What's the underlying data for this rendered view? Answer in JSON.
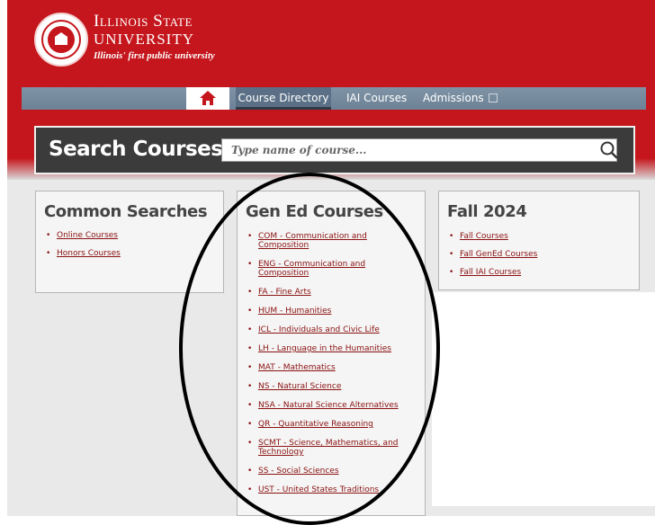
{
  "brand": {
    "name_line1": "Illinois State",
    "name_line2": "UNIVERSITY",
    "tagline": "Illinois' first public university",
    "colors": {
      "primary_red": "#c4161c",
      "nav_gray": "#7f93a6",
      "link_red": "#8a1111"
    }
  },
  "nav": {
    "home_icon": "home-icon",
    "items": [
      {
        "label": "Course Directory",
        "active": true
      },
      {
        "label": "IAI Courses",
        "active": false
      },
      {
        "label": "Admissions",
        "active": false,
        "icon": "external-link-icon"
      }
    ]
  },
  "search": {
    "title": "Search Courses",
    "placeholder": "Type name of course...",
    "icon": "search-icon"
  },
  "common_searches": {
    "title": "Common Searches",
    "items": [
      "Online Courses",
      "Honors Courses"
    ]
  },
  "gen_ed": {
    "title": "Gen Ed Courses",
    "items": [
      "COM - Communication and Composition",
      "ENG - Communication and Composition",
      "FA - Fine Arts",
      "HUM - Humanities",
      "ICL - Individuals and Civic Life",
      "LH - Language in the Humanities",
      "MAT - Mathematics",
      "NS - Natural Science",
      "NSA - Natural Science Alternatives",
      "QR - Quantitative Reasoning",
      "SCMT - Science, Mathematics, and Technology",
      "SS - Social Sciences",
      "UST - United States Traditions"
    ]
  },
  "fall": {
    "title": "Fall 2024",
    "items": [
      "Fall Courses",
      "Fall GenEd Courses",
      "Fall IAI Courses"
    ]
  }
}
